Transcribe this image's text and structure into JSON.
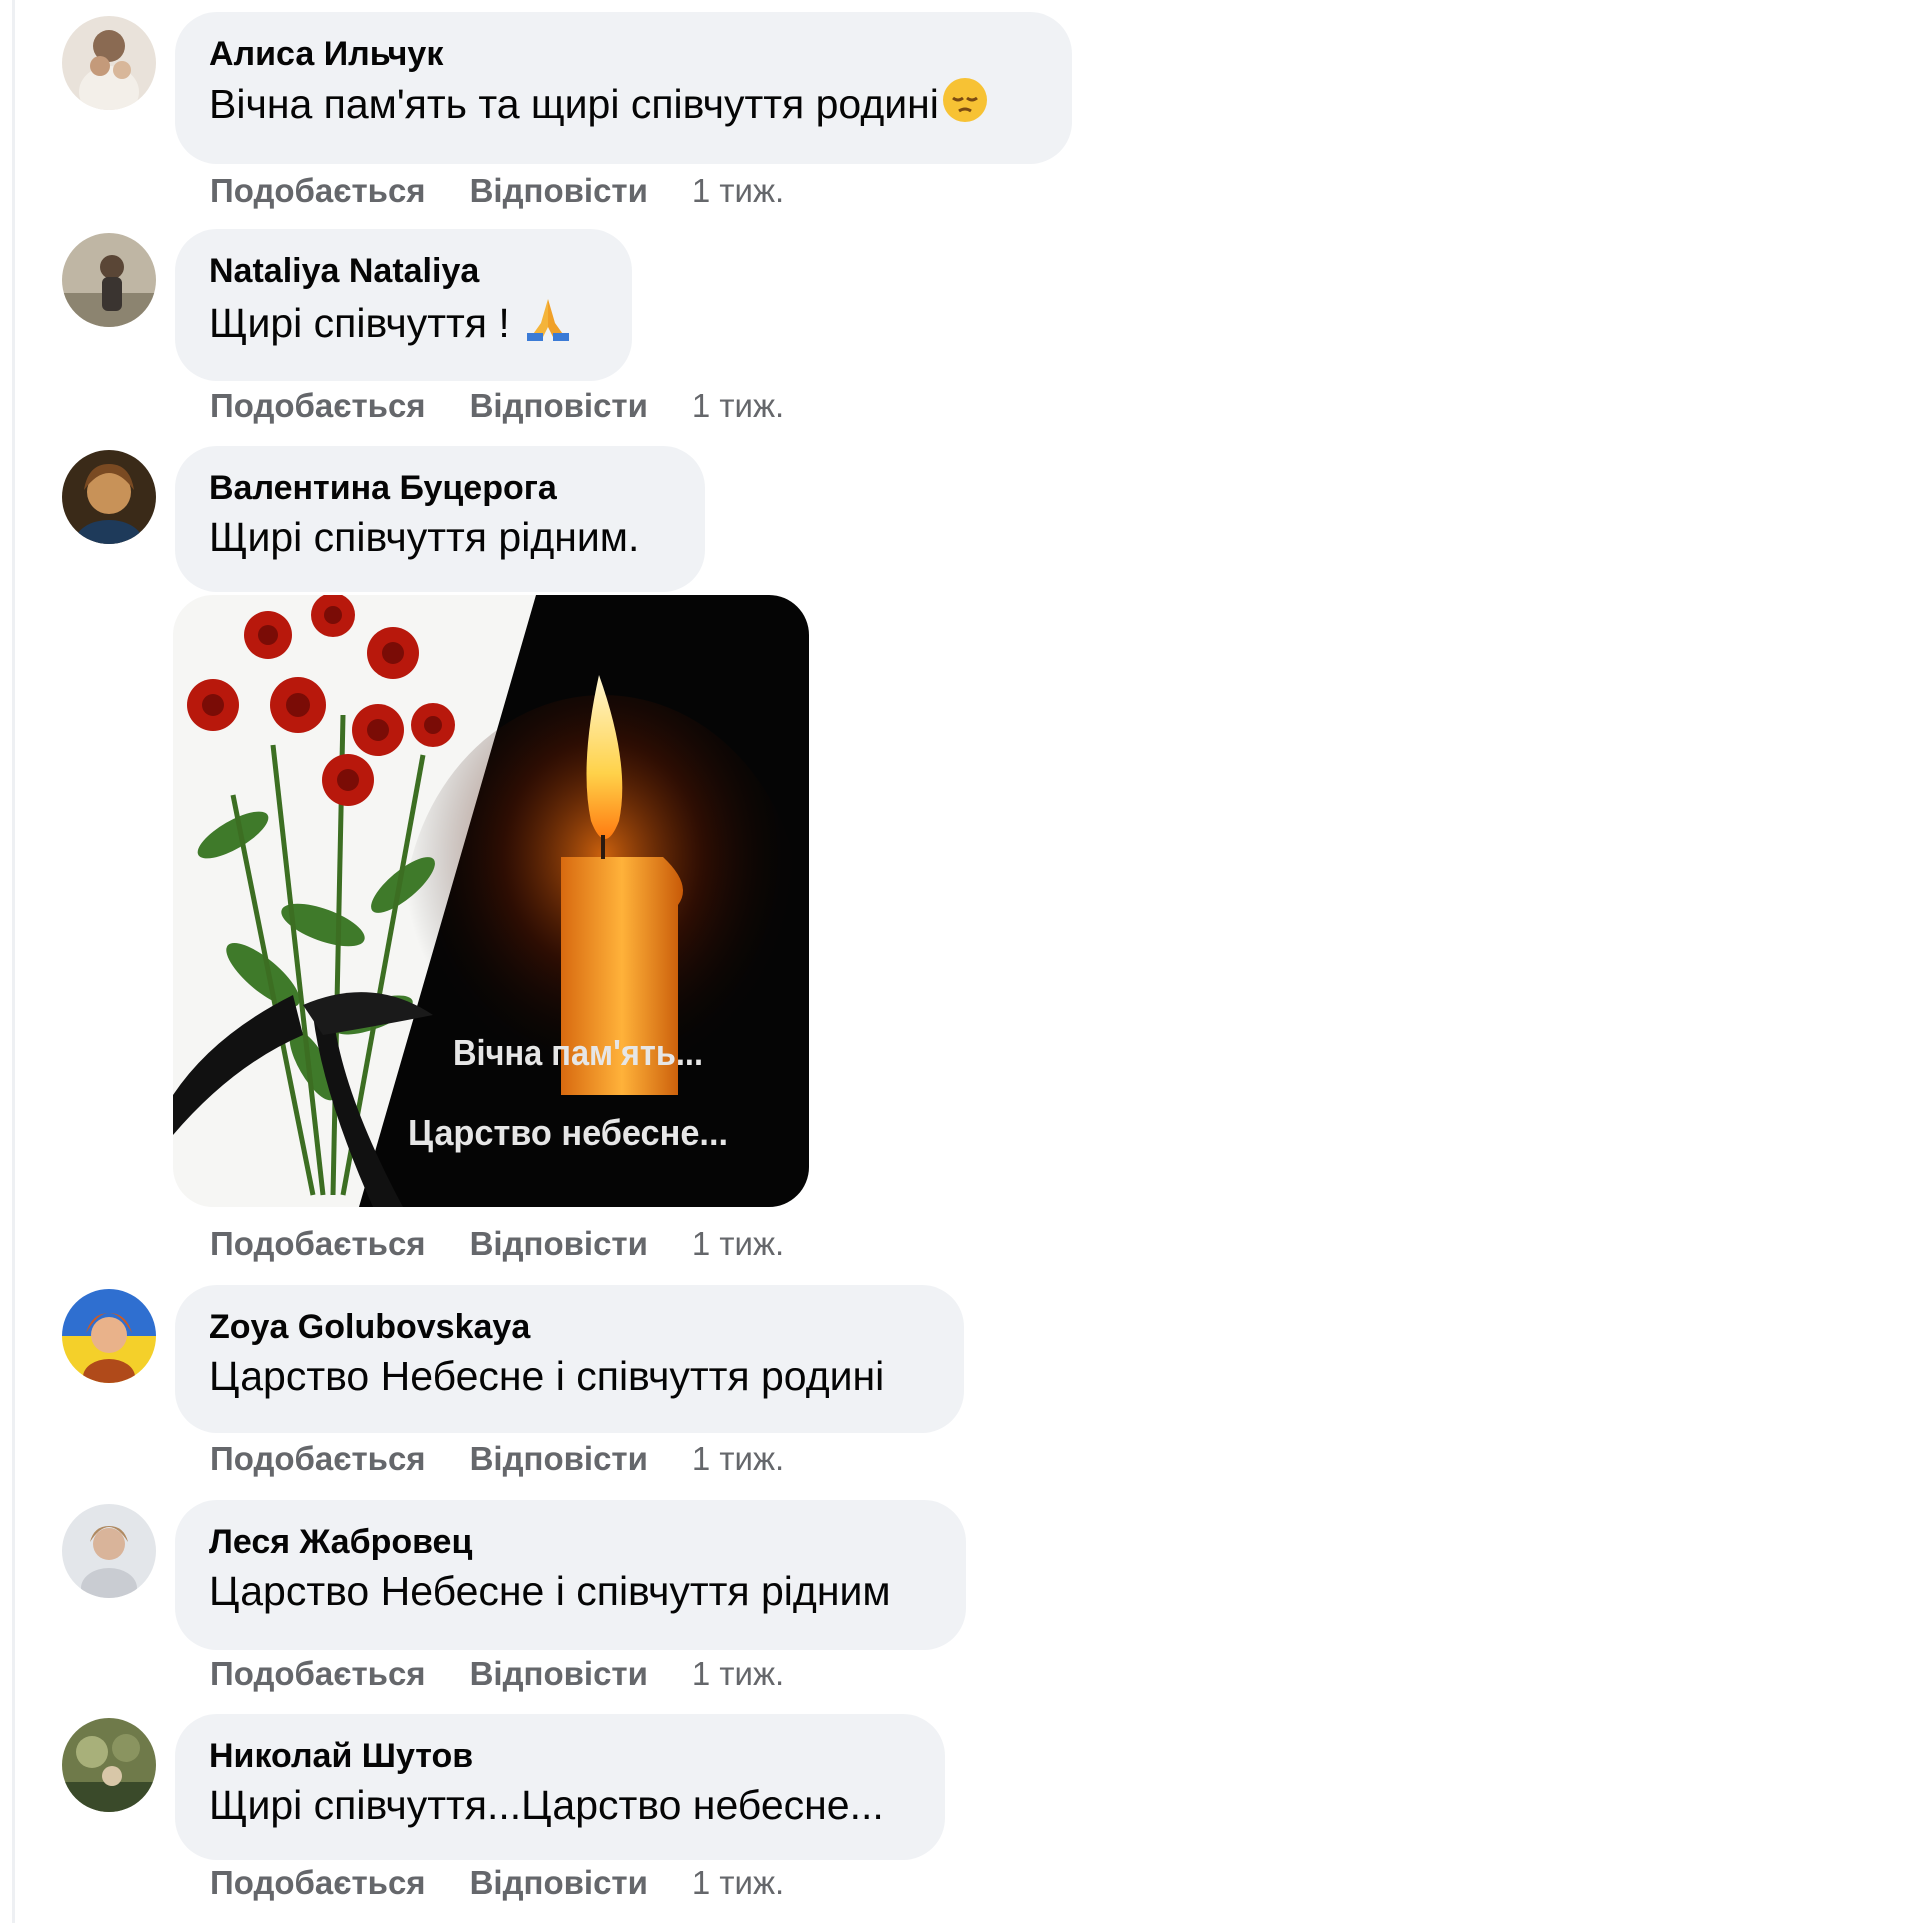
{
  "actions": {
    "like": "Подобається",
    "reply": "Відповісти",
    "time": "1 тиж."
  },
  "comments": [
    {
      "author": "Алиса Ильчук",
      "text": "Вічна пам'ять та щирі співчуття родині",
      "emoji": "pensive-face-emoji"
    },
    {
      "author": "Nataliya Nataliya",
      "text": "Щирі співчуття ! ",
      "emoji": "folded-hands-emoji"
    },
    {
      "author": "Валентина Буцерога",
      "text": "Щирі співчуття рідним."
    },
    {
      "author": "Zoya Golubovskaya",
      "text": "Царство Небесне і співчуття родині"
    },
    {
      "author": "Леся Жабровец",
      "text": "Царство Небесне і співчуття рідним"
    },
    {
      "author": "Николай Шутов",
      "text": "Щирі співчуття...Царство небесне..."
    }
  ],
  "attachment": {
    "line1": "Вічна пам'ять...",
    "line2": "Царство небесне..."
  },
  "colors": {
    "bubble": "#f0f2f5",
    "action_text": "#65676b",
    "name_text": "#050505"
  }
}
